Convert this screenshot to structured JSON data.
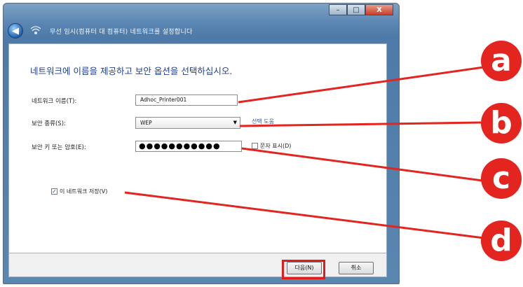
{
  "window": {
    "minimize_glyph": "–",
    "maximize_glyph": "□",
    "close_glyph": "X"
  },
  "nav": {
    "back_glyph": "◀",
    "title": "무선 임시(컴퓨터 대 컴퓨터) 네트워크를 설정합니다"
  },
  "content": {
    "heading": "네트워크에 이름을 제공하고 보안 옵션을 선택하십시오.",
    "network_name_label": "네트워크 이름(T):",
    "network_name_value": "Adhoc_Printer001",
    "security_type_label": "보안 종류(S):",
    "security_type_value": "WEP",
    "help_link": "선택 도움",
    "security_key_label": "보안 키 또는 암호(E):",
    "security_key_value": "●●●●●●●●●●●",
    "show_chars_label": "문자 표시(D)",
    "show_chars_checked": false,
    "save_network_label": "이 네트워크 저장(V)",
    "save_network_checked": true
  },
  "buttons": {
    "next_label": "다음(N)",
    "cancel_label": "취소"
  },
  "callouts": [
    "a",
    "b",
    "c",
    "d"
  ],
  "colors": {
    "callout_red": "#e3241f",
    "heading_blue": "#1f3f8f"
  }
}
